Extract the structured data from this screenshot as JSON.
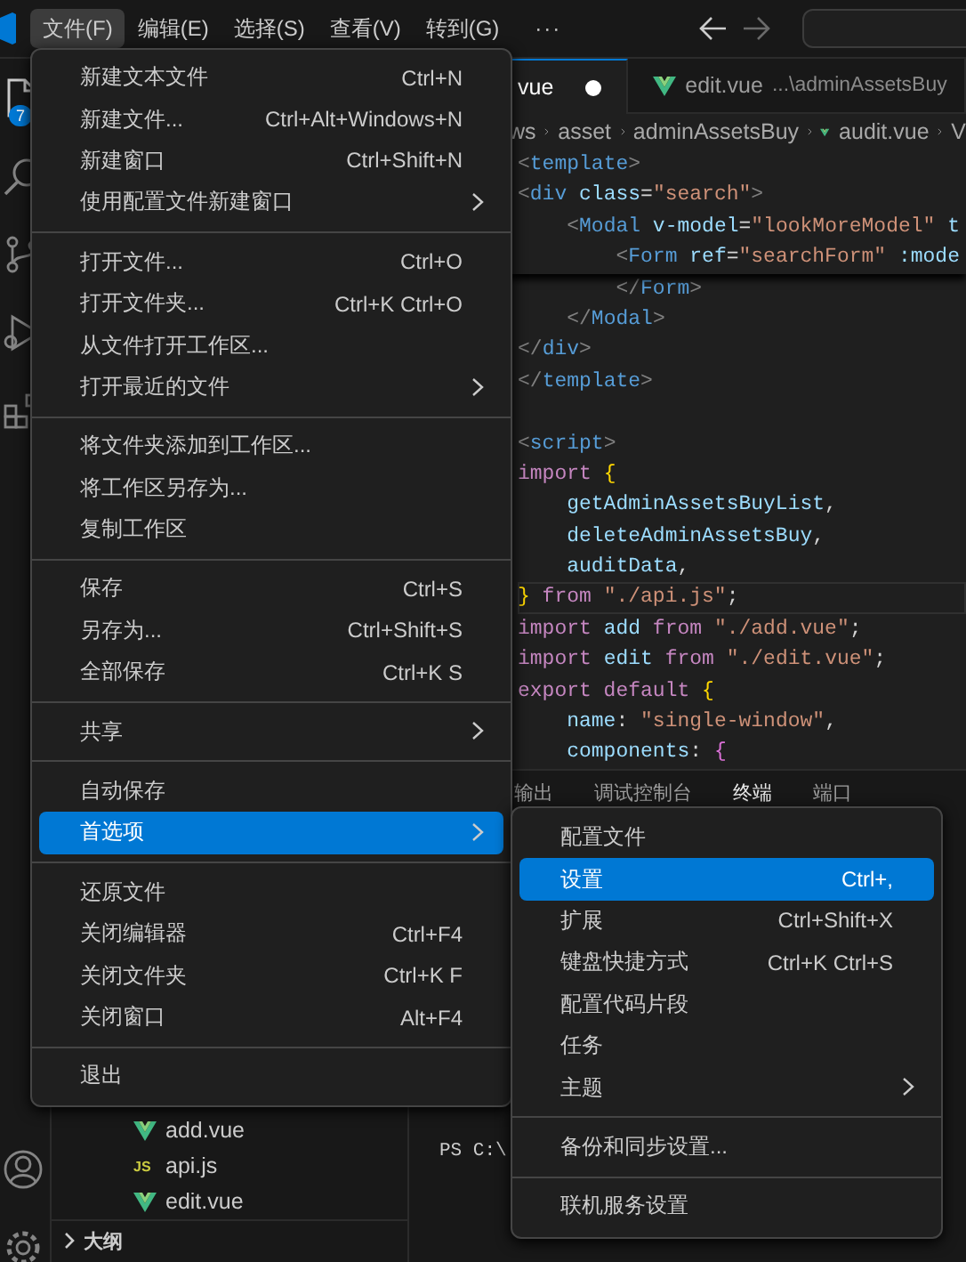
{
  "title_bar": {
    "menus": [
      {
        "label": "文件(F)",
        "selected": true
      },
      {
        "label": "编辑(E)",
        "selected": false
      },
      {
        "label": "选择(S)",
        "selected": false
      },
      {
        "label": "查看(V)",
        "selected": false
      },
      {
        "label": "转到(G)",
        "selected": false
      }
    ],
    "overflow": "···",
    "navigation": [
      {
        "kind": "back",
        "disabled": false
      },
      {
        "kind": "forward",
        "disabled": true
      }
    ]
  },
  "activity_bar": {
    "badge": "7"
  },
  "editor": {
    "tabs": [
      {
        "label": "vue",
        "selected": true,
        "modified": true
      },
      {
        "label": "edit.vue",
        "description": "...\\adminAssetsBuy",
        "kind": "vue",
        "selected": false,
        "modified": false
      }
    ],
    "breadcrumb": [
      {
        "label": "ws"
      },
      {
        "label": "asset"
      },
      {
        "label": "adminAssetsBuy"
      },
      {
        "label": "audit.vue",
        "kind": "vue"
      },
      {
        "label": "V"
      }
    ],
    "sticky_lines": [
      {
        "kind": "code",
        "tokens": [
          {
            "kind": "tagp",
            "text": "<"
          },
          {
            "kind": "tag",
            "text": "template"
          },
          {
            "kind": "tagp",
            "text": ">"
          }
        ]
      },
      {
        "kind": "code",
        "tokens": [
          {
            "kind": "tagp",
            "text": "<"
          },
          {
            "kind": "tag",
            "text": "div"
          },
          {
            "kind": "attr",
            "text": " class"
          },
          {
            "kind": "punct",
            "text": "="
          },
          {
            "kind": "string",
            "text": "\"search\""
          },
          {
            "kind": "tagp",
            "text": ">"
          }
        ]
      },
      {
        "kind": "code",
        "tokens": [
          {
            "kind": "tagp",
            "text": "    <"
          },
          {
            "kind": "tag",
            "text": "Modal"
          },
          {
            "kind": "attr",
            "text": " v-model"
          },
          {
            "kind": "punct",
            "text": "="
          },
          {
            "kind": "string",
            "text": "\"lookMoreModel\""
          },
          {
            "kind": "attr",
            "text": " t"
          }
        ]
      },
      {
        "kind": "code",
        "tokens": [
          {
            "kind": "tagp",
            "text": "        <"
          },
          {
            "kind": "tag",
            "text": "Form"
          },
          {
            "kind": "attr",
            "text": " ref"
          },
          {
            "kind": "punct",
            "text": "="
          },
          {
            "kind": "string",
            "text": "\"searchForm\""
          },
          {
            "kind": "attr",
            "text": " :mode"
          }
        ]
      }
    ],
    "lines": [
      {
        "kind": "code",
        "tokens": [
          {
            "kind": "tagp",
            "text": "        </"
          },
          {
            "kind": "tag",
            "text": "Form"
          },
          {
            "kind": "tagp",
            "text": ">"
          }
        ]
      },
      {
        "kind": "code",
        "tokens": [
          {
            "kind": "tagp",
            "text": "    </"
          },
          {
            "kind": "tag",
            "text": "Modal"
          },
          {
            "kind": "tagp",
            "text": ">"
          }
        ]
      },
      {
        "kind": "code",
        "tokens": [
          {
            "kind": "tagp",
            "text": "</"
          },
          {
            "kind": "tag",
            "text": "div"
          },
          {
            "kind": "tagp",
            "text": ">"
          }
        ]
      },
      {
        "kind": "code",
        "tokens": [
          {
            "kind": "tagp",
            "text": "</"
          },
          {
            "kind": "tag",
            "text": "template"
          },
          {
            "kind": "tagp",
            "text": ">"
          }
        ]
      },
      {
        "kind": "blank"
      },
      {
        "kind": "code",
        "tokens": [
          {
            "kind": "tagp",
            "text": "<"
          },
          {
            "kind": "tag",
            "text": "script"
          },
          {
            "kind": "tagp",
            "text": ">"
          }
        ]
      },
      {
        "kind": "code",
        "tokens": [
          {
            "kind": "keyword",
            "text": "import"
          },
          {
            "kind": "brace",
            "text": " {"
          }
        ]
      },
      {
        "kind": "code",
        "tokens": [
          {
            "kind": "var",
            "text": "    getAdminAssetsBuyList"
          },
          {
            "kind": "punct",
            "text": ","
          }
        ]
      },
      {
        "kind": "code",
        "tokens": [
          {
            "kind": "var",
            "text": "    deleteAdminAssetsBuy"
          },
          {
            "kind": "punct",
            "text": ","
          }
        ]
      },
      {
        "kind": "code",
        "tokens": [
          {
            "kind": "var",
            "text": "    auditData"
          },
          {
            "kind": "punct",
            "text": ","
          }
        ]
      },
      {
        "kind": "code",
        "current": true,
        "tokens": [
          {
            "kind": "brace",
            "text": "}"
          },
          {
            "kind": "keyword",
            "text": " from"
          },
          {
            "kind": "string",
            "text": " \"./api.js\""
          },
          {
            "kind": "punct",
            "text": ";"
          }
        ]
      },
      {
        "kind": "code",
        "tokens": [
          {
            "kind": "keyword",
            "text": "import"
          },
          {
            "kind": "var",
            "text": " add"
          },
          {
            "kind": "keyword",
            "text": " from"
          },
          {
            "kind": "string",
            "text": " \"./add.vue\""
          },
          {
            "kind": "punct",
            "text": ";"
          }
        ]
      },
      {
        "kind": "code",
        "tokens": [
          {
            "kind": "keyword",
            "text": "import"
          },
          {
            "kind": "var",
            "text": " edit"
          },
          {
            "kind": "keyword",
            "text": " from"
          },
          {
            "kind": "string",
            "text": " \"./edit.vue\""
          },
          {
            "kind": "punct",
            "text": ";"
          }
        ]
      },
      {
        "kind": "code",
        "tokens": [
          {
            "kind": "keyword",
            "text": "export default"
          },
          {
            "kind": "brace",
            "text": " {"
          }
        ]
      },
      {
        "kind": "code",
        "tokens": [
          {
            "kind": "var",
            "text": "    name"
          },
          {
            "kind": "punct",
            "text": ": "
          },
          {
            "kind": "string",
            "text": "\"single-window\""
          },
          {
            "kind": "punct",
            "text": ","
          }
        ]
      },
      {
        "kind": "code",
        "tokens": [
          {
            "kind": "var",
            "text": "    components"
          },
          {
            "kind": "punct",
            "text": ": "
          },
          {
            "kind": "brace2",
            "text": "{"
          }
        ]
      }
    ]
  },
  "panel": {
    "tabs": [
      {
        "label": "输出",
        "selected": false
      },
      {
        "label": "调试控制台",
        "selected": false
      },
      {
        "label": "终端",
        "selected": true
      },
      {
        "label": "端口",
        "selected": false
      }
    ],
    "terminal_text": "PS C:\\"
  },
  "explorer": {
    "files": [
      {
        "name": "add.vue",
        "kind": "vue"
      },
      {
        "name": "api.js",
        "kind": "js",
        "icon_label": "JS"
      },
      {
        "name": "edit.vue",
        "kind": "vue"
      }
    ],
    "outline": {
      "label": "大纲",
      "expanded": false
    }
  },
  "file_menu": {
    "groups": [
      [
        {
          "label": "新建文本文件",
          "shortcut": "Ctrl+N",
          "submenu": false,
          "selected": false
        },
        {
          "label": "新建文件...",
          "shortcut": "Ctrl+Alt+Windows+N",
          "submenu": false,
          "selected": false
        },
        {
          "label": "新建窗口",
          "shortcut": "Ctrl+Shift+N",
          "submenu": false,
          "selected": false
        },
        {
          "label": "使用配置文件新建窗口",
          "submenu": true,
          "selected": false
        }
      ],
      [
        {
          "label": "打开文件...",
          "shortcut": "Ctrl+O",
          "submenu": false,
          "selected": false
        },
        {
          "label": "打开文件夹...",
          "shortcut": "Ctrl+K Ctrl+O",
          "submenu": false,
          "selected": false
        },
        {
          "label": "从文件打开工作区...",
          "submenu": false,
          "selected": false
        },
        {
          "label": "打开最近的文件",
          "submenu": true,
          "selected": false
        }
      ],
      [
        {
          "label": "将文件夹添加到工作区...",
          "submenu": false,
          "selected": false
        },
        {
          "label": "将工作区另存为...",
          "submenu": false,
          "selected": false
        },
        {
          "label": "复制工作区",
          "submenu": false,
          "selected": false
        }
      ],
      [
        {
          "label": "保存",
          "shortcut": "Ctrl+S",
          "submenu": false,
          "selected": false
        },
        {
          "label": "另存为...",
          "shortcut": "Ctrl+Shift+S",
          "submenu": false,
          "selected": false
        },
        {
          "label": "全部保存",
          "shortcut": "Ctrl+K S",
          "submenu": false,
          "selected": false
        }
      ],
      [
        {
          "label": "共享",
          "submenu": true,
          "selected": false
        }
      ],
      [
        {
          "label": "自动保存",
          "submenu": false,
          "selected": false
        },
        {
          "label": "首选项",
          "submenu": true,
          "selected": true
        }
      ],
      [
        {
          "label": "还原文件",
          "submenu": false,
          "selected": false
        },
        {
          "label": "关闭编辑器",
          "shortcut": "Ctrl+F4",
          "submenu": false,
          "selected": false
        },
        {
          "label": "关闭文件夹",
          "shortcut": "Ctrl+K F",
          "submenu": false,
          "selected": false
        },
        {
          "label": "关闭窗口",
          "shortcut": "Alt+F4",
          "submenu": false,
          "selected": false
        }
      ],
      [
        {
          "label": "退出",
          "submenu": false,
          "selected": false
        }
      ]
    ]
  },
  "preferences_submenu": {
    "groups": [
      [
        {
          "label": "配置文件",
          "submenu": false,
          "selected": false
        },
        {
          "label": "设置",
          "shortcut": "Ctrl+,",
          "submenu": false,
          "selected": true
        },
        {
          "label": "扩展",
          "shortcut": "Ctrl+Shift+X",
          "submenu": false,
          "selected": false
        },
        {
          "label": "键盘快捷方式",
          "shortcut": "Ctrl+K Ctrl+S",
          "submenu": false,
          "selected": false
        },
        {
          "label": "配置代码片段",
          "submenu": false,
          "selected": false
        },
        {
          "label": "任务",
          "submenu": false,
          "selected": false
        },
        {
          "label": "主题",
          "submenu": true,
          "selected": false
        }
      ],
      [
        {
          "label": "备份和同步设置...",
          "submenu": false,
          "selected": false
        }
      ],
      [
        {
          "label": "联机服务设置",
          "submenu": false,
          "selected": false
        }
      ]
    ]
  }
}
